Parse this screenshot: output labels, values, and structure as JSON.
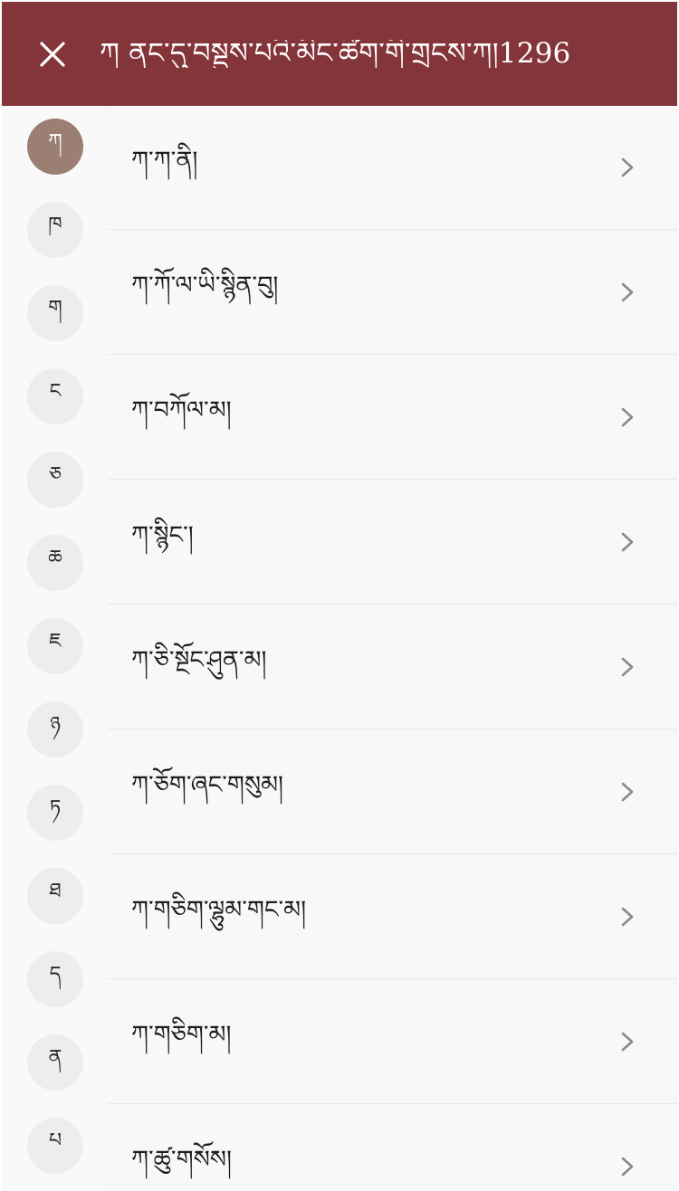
{
  "header": {
    "close_icon": "close-icon",
    "title": "ཀ ནང་དུ་བསྡུས་པའི་མིང་ཚིག་གི་གྲངས་ཀ།1296"
  },
  "sidebar": {
    "letters": [
      {
        "label": "ཀ",
        "active": true
      },
      {
        "label": "ཁ",
        "active": false
      },
      {
        "label": "ག",
        "active": false
      },
      {
        "label": "ང",
        "active": false
      },
      {
        "label": "ཅ",
        "active": false
      },
      {
        "label": "ཆ",
        "active": false
      },
      {
        "label": "ཇ",
        "active": false
      },
      {
        "label": "ཉ",
        "active": false
      },
      {
        "label": "ཏ",
        "active": false
      },
      {
        "label": "ཐ",
        "active": false
      },
      {
        "label": "ད",
        "active": false
      },
      {
        "label": "ན",
        "active": false
      },
      {
        "label": "པ",
        "active": false
      }
    ]
  },
  "list": {
    "items": [
      {
        "label": "ཀ་ཀ་ནི།"
      },
      {
        "label": "ཀ་ཀོ་ལ་ཡི་སྙིན་བུ།"
      },
      {
        "label": "ཀ་བཀོལ་མ།"
      },
      {
        "label": "ཀ་སྙིང་།"
      },
      {
        "label": "ཀ་ཅི་སྔོང་ཤུན་མ།"
      },
      {
        "label": "ཀ་ཅོག་ཞང་གསུམ།"
      },
      {
        "label": "ཀ་གཅིག་ལྷུམ་གང་མ།"
      },
      {
        "label": "ཀ་གཅིག་མ།"
      },
      {
        "label": "ཀ་ཚུ་གསོས།"
      }
    ],
    "chevron_icon": "chevron-right-icon"
  },
  "colors": {
    "header_bg": "#84353a",
    "active_letter_bg": "#9b7f72",
    "letter_bg": "#ededed"
  }
}
